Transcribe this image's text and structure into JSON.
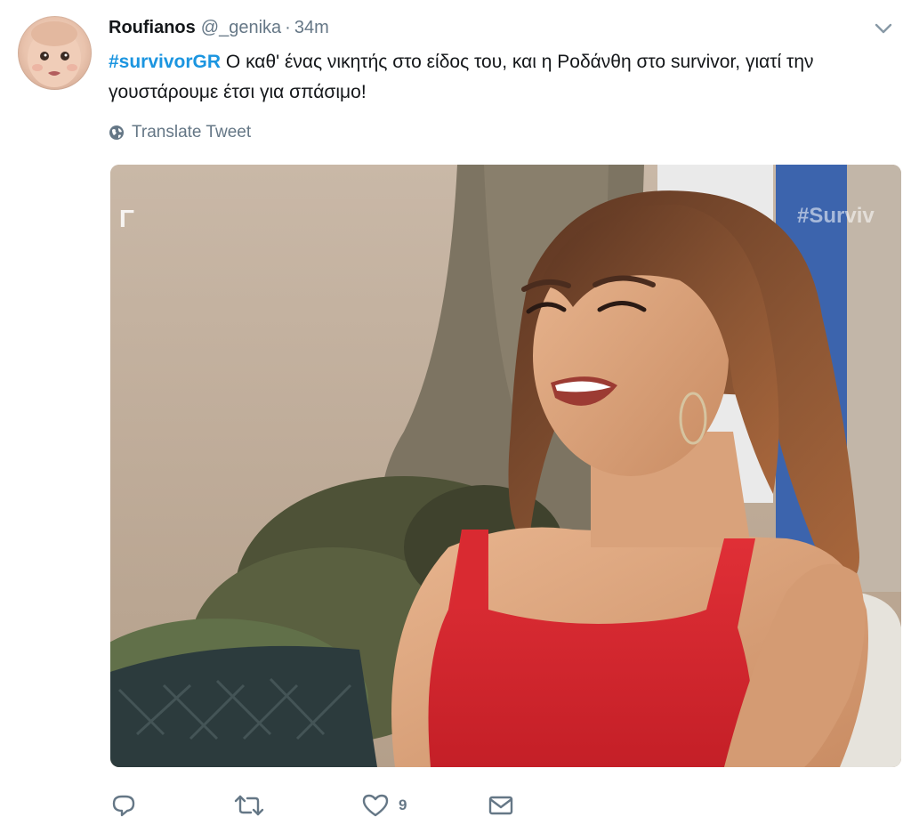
{
  "tweet": {
    "author_name": "Roufianos",
    "handle": "@_genika",
    "separator": "·",
    "time": "34m",
    "hashtag": "#survivorGR",
    "text": " Ο καθ' ένας νικητής στο είδος του, και η Ροδάνθη στο survivor, γιατί την γουστάρουμε έτσι για σπάσιμο!",
    "translate_label": "Translate Tweet"
  },
  "media": {
    "watermark_left": "Γ",
    "watermark_right": "#Surviv"
  },
  "actions": {
    "reply_count": "",
    "retweet_count": "",
    "like_count": "9"
  },
  "icons": {
    "caret": "chevron-down-icon",
    "globe": "globe-icon",
    "reply": "reply-icon",
    "retweet": "retweet-icon",
    "like": "heart-icon",
    "dm": "envelope-icon"
  },
  "colors": {
    "hashtag": "#1b95e0",
    "secondary_text": "#657786",
    "dress": "#d8262c"
  }
}
